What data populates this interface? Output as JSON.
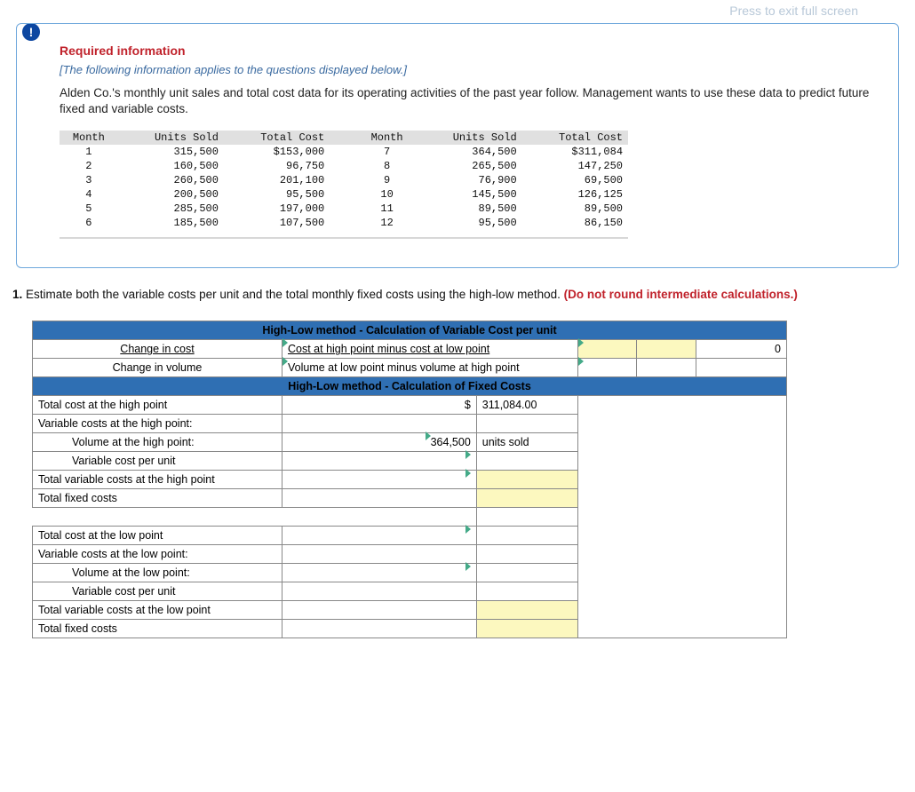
{
  "hint": "Press     to exit full screen",
  "alert_icon": "!",
  "header": {
    "required": "Required information",
    "sub": "[The following information applies to the questions displayed below.]",
    "para": "Alden Co.'s monthly unit sales and total cost data for its operating activities of the past year follow. Management wants to use these data to predict future fixed and variable costs."
  },
  "data_table": {
    "headers": [
      "Month",
      "Units Sold",
      "Total Cost",
      "Month",
      "Units Sold",
      "Total Cost"
    ],
    "rows": [
      {
        "m1": "1",
        "u1": "315,500",
        "c1": "$153,000",
        "m2": "7",
        "u2": "364,500",
        "c2": "$311,084"
      },
      {
        "m1": "2",
        "u1": "160,500",
        "c1": "96,750",
        "m2": "8",
        "u2": "265,500",
        "c2": "147,250"
      },
      {
        "m1": "3",
        "u1": "260,500",
        "c1": "201,100",
        "m2": "9",
        "u2": "76,900",
        "c2": "69,500"
      },
      {
        "m1": "4",
        "u1": "200,500",
        "c1": "95,500",
        "m2": "10",
        "u2": "145,500",
        "c2": "126,125"
      },
      {
        "m1": "5",
        "u1": "285,500",
        "c1": "197,000",
        "m2": "11",
        "u2": "89,500",
        "c2": "89,500"
      },
      {
        "m1": "6",
        "u1": "185,500",
        "c1": "107,500",
        "m2": "12",
        "u2": "95,500",
        "c2": "86,150"
      }
    ]
  },
  "question": {
    "num": "1.",
    "text": " Estimate both the variable costs per unit and the total monthly fixed costs using the high-low method. ",
    "red": "(Do not round intermediate calculations.)"
  },
  "hl": {
    "title_var": "High-Low method - Calculation of Variable Cost per unit",
    "change_cost": "Change in cost",
    "change_cost_desc": "Cost at high point minus cost at low point",
    "zero": "0",
    "change_vol": "Change in volume",
    "change_vol_desc": "Volume at low point minus volume at high point",
    "title_fix": "High-Low method - Calculation of Fixed Costs",
    "rows_h": [
      {
        "label": "Total cost at the high point",
        "v1": "$",
        "v2": "311,084.00",
        "tag": ""
      },
      {
        "label": "Variable costs at the high point:",
        "v1": "",
        "v2": "",
        "tag": ""
      },
      {
        "label": "Volume at the high point:",
        "indent": "indent4",
        "v1": "364,500",
        "v2": "units sold",
        "flag": true
      },
      {
        "label": "Variable cost per unit",
        "indent": "indent4",
        "v1": "",
        "v2": "",
        "flag": true
      },
      {
        "label": "Total variable costs at the high point",
        "v1": "",
        "v2": "",
        "flag": true,
        "yellow": true
      },
      {
        "label": "Total fixed costs",
        "v1": "",
        "v2": "",
        "yellow": true
      }
    ],
    "rows_l": [
      {
        "label": "Total cost at the low point",
        "v1": "",
        "v2": "",
        "flag": true
      },
      {
        "label": "Variable costs at the low point:",
        "v1": "",
        "v2": ""
      },
      {
        "label": "Volume at the low point:",
        "indent": "indent4",
        "v1": "",
        "v2": "",
        "flag": true
      },
      {
        "label": "Variable cost per unit",
        "indent": "indent4",
        "v1": "",
        "v2": ""
      },
      {
        "label": "Total variable costs at the low point",
        "v1": "",
        "v2": "",
        "yellow": true
      },
      {
        "label": "Total fixed costs",
        "v1": "",
        "v2": "",
        "yellow": true
      }
    ]
  }
}
